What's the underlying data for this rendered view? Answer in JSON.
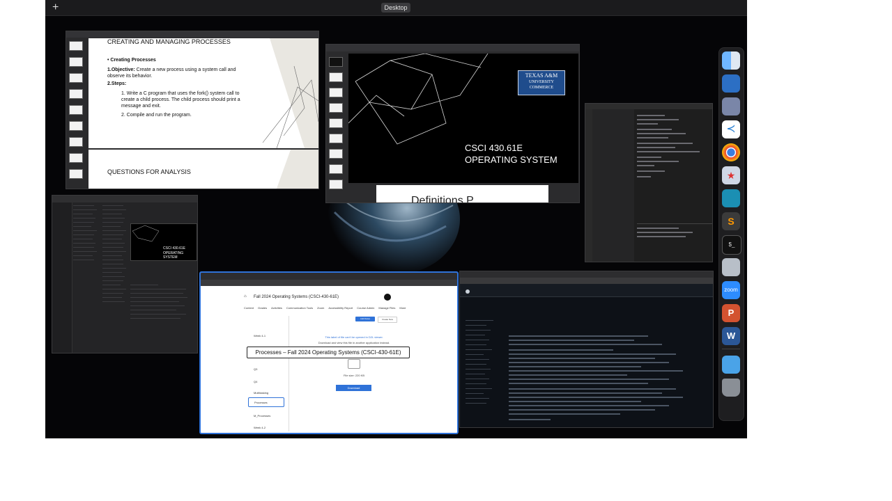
{
  "topbar": {
    "add_label": "+",
    "desktop_label": "Desktop"
  },
  "ppt_window": {
    "slide_title": "CREATING AND MANAGING PROCESSES",
    "heading": "Creating Processes",
    "objective_label": "1.Objective:",
    "objective_text": "Create a new process using a system call and observe its behavior.",
    "steps_label": "2.Steps:",
    "step1": "1. Write a C program that uses the fork() system call to create a child process. The child process should print a message and exit.",
    "step2": "2. Compile and run the program.",
    "next_slide_title": "QUESTIONS FOR ANALYSIS"
  },
  "slide_window": {
    "logo_line1": "TEXAS A&M",
    "logo_line2": "UNIVERSITY",
    "logo_line3": "COMMERCE",
    "course": "CSCI 430.61E",
    "subtitle": "OPERATING SYSTEM",
    "next_slide_partial": "Definitions P"
  },
  "finder_window": {
    "preview_course": "CSCI 430.61E",
    "preview_subtitle": "OPERATING SYSTEM"
  },
  "browser_window": {
    "course_title": "Fall 2024 Operating Systems (CSCI-430-61E)",
    "menu": [
      "Content",
      "Grades",
      "Activities",
      "Communication Tools",
      "Zoom",
      "Accessibility Report",
      "Course Admin",
      "Manage Files",
      "More"
    ],
    "sidebar_items": [
      "Week 4-1",
      "Q3",
      "Q4",
      "Multitasking",
      "Processes",
      "M_Processes",
      "Week 4-2"
    ],
    "notice": "This label of file can't be opened in D2L viewer.",
    "notice2": "Download and view this file in another application instead.",
    "file_size": "File size: 220 KB",
    "download_label": "Download",
    "add_dates": "Add Dates",
    "create_new": "Create New"
  },
  "caption": "Processes – Fall 2024 Operating Systems (CSCI-430-61E)",
  "dock": [
    "finder-icon",
    "preview-icon",
    "drive-icon",
    "vscode-icon",
    "chrome-icon",
    "launchpad-icon",
    "app-icon",
    "sublime-icon",
    "terminal-icon",
    "disk-icon",
    "zoom-icon",
    "powerpoint-icon",
    "word-icon",
    "folder-icon",
    "trash-icon"
  ],
  "dock_labels": {
    "zoom": "zoom",
    "powerpoint": "P",
    "word": "W",
    "terminal": "$_"
  },
  "colors": {
    "desktop_bg": "#050507",
    "accent_blue": "#2f72d8",
    "tamu_blue": "#1f4c8c"
  }
}
